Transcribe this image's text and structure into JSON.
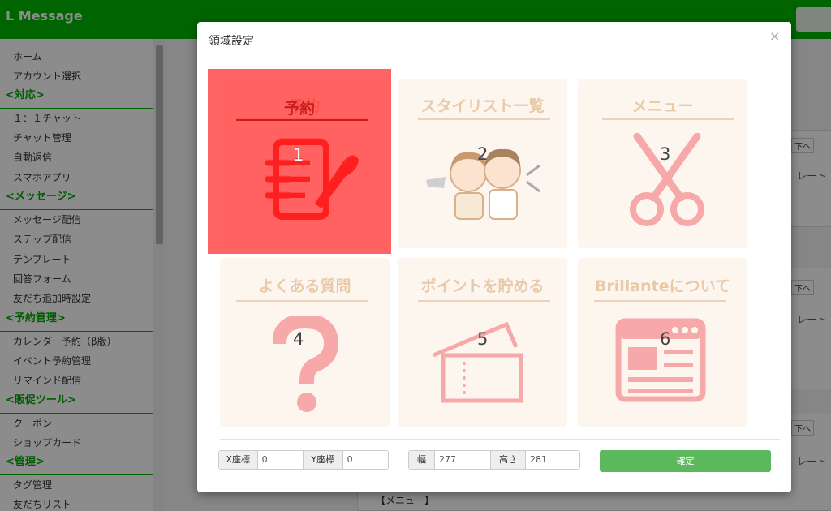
{
  "app": {
    "title": "L Message"
  },
  "sidebar": {
    "items": [
      {
        "type": "item",
        "label": "ホーム"
      },
      {
        "type": "item",
        "label": "アカウント選択"
      },
      {
        "type": "head",
        "label": "<対応>"
      },
      {
        "type": "item",
        "label": "１：１チャット"
      },
      {
        "type": "item",
        "label": "チャット管理"
      },
      {
        "type": "item",
        "label": "自動返信"
      },
      {
        "type": "item",
        "label": "スマホアプリ"
      },
      {
        "type": "head",
        "label": "<メッセージ>"
      },
      {
        "type": "item",
        "label": "メッセージ配信"
      },
      {
        "type": "item",
        "label": "ステップ配信"
      },
      {
        "type": "item",
        "label": "テンプレート"
      },
      {
        "type": "item",
        "label": "回答フォーム"
      },
      {
        "type": "item",
        "label": "友だち追加時設定"
      },
      {
        "type": "head",
        "label": "<予約管理>"
      },
      {
        "type": "item",
        "label": "カレンダー予約（β版）"
      },
      {
        "type": "item",
        "label": "イベント予約管理"
      },
      {
        "type": "item",
        "label": "リマインド配信"
      },
      {
        "type": "head",
        "label": "<販促ツール>"
      },
      {
        "type": "item",
        "label": "クーポン"
      },
      {
        "type": "item",
        "label": "ショップカード"
      },
      {
        "type": "head",
        "label": "<管理>"
      },
      {
        "type": "item",
        "label": "タグ管理"
      },
      {
        "type": "item",
        "label": "友だちリスト"
      }
    ]
  },
  "background": {
    "down_label": "下へ",
    "side_text": "レート",
    "menu_field_value": "【メニュー】"
  },
  "modal": {
    "title": "領域設定",
    "close": "×",
    "tiles": [
      {
        "number": "1",
        "title": "予約",
        "icon": "reservation-form-icon"
      },
      {
        "number": "2",
        "title": "スタイリスト一覧",
        "icon": "stylists-illustration"
      },
      {
        "number": "3",
        "title": "メニュー",
        "icon": "scissors-icon"
      },
      {
        "number": "4",
        "title": "よくある質問",
        "icon": "question-mark-icon"
      },
      {
        "number": "5",
        "title": "ポイントを貯める",
        "icon": "ticket-icon"
      },
      {
        "number": "6",
        "title": "Brillanteについて",
        "icon": "webpage-icon"
      }
    ],
    "selected_tile": "1",
    "fields": {
      "x_label": "X座標",
      "x_value": "0",
      "y_label": "Y座標",
      "y_value": "0",
      "w_label": "幅",
      "w_value": "277",
      "h_label": "高さ",
      "h_value": "281"
    },
    "confirm_label": "確定"
  },
  "colors": {
    "brand": "#00b900",
    "selection": "#ff2828",
    "tile_bg": "#fdf6ef",
    "tile_text": "#e8c9a8",
    "icon_pink": "#f7a8a8",
    "confirm": "#5cb85c"
  }
}
